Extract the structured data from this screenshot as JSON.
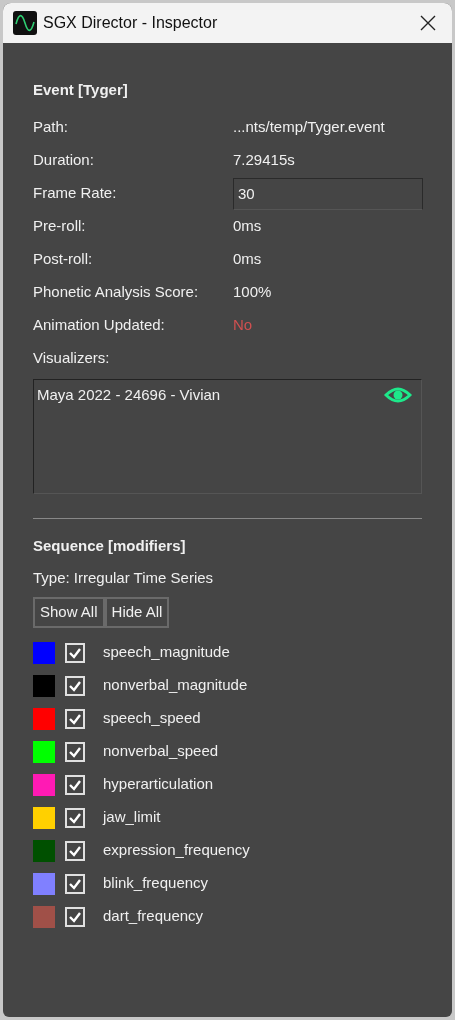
{
  "window": {
    "title": "SGX Director - Inspector"
  },
  "event": {
    "heading": "Event [Tyger]",
    "fields": [
      {
        "kind": "text",
        "label": "Path:",
        "value": "...nts/temp/Tyger.event"
      },
      {
        "kind": "text",
        "label": "Duration:",
        "value": "7.29415s"
      },
      {
        "kind": "input",
        "label": "Frame Rate:",
        "value": "30"
      },
      {
        "kind": "text",
        "label": "Pre-roll:",
        "value": "0ms"
      },
      {
        "kind": "text",
        "label": "Post-roll:",
        "value": "0ms"
      },
      {
        "kind": "text",
        "label": "Phonetic Analysis Score:",
        "value": "100%"
      },
      {
        "kind": "warning",
        "label": "Animation Updated:",
        "value": "No"
      }
    ],
    "visualizers_label": "Visualizers:",
    "visualizers": [
      {
        "name": "Maya 2022 - 24696 - Vivian",
        "visible": true
      }
    ]
  },
  "sequence": {
    "heading": "Sequence [modifiers]",
    "type": "Type: Irregular Time Series",
    "buttons": [
      "Show All",
      "Hide All"
    ],
    "modifiers": [
      {
        "name": "speech_magnitude",
        "color": "#0000ff",
        "checked": true
      },
      {
        "name": "nonverbal_magnitude",
        "color": "#000000",
        "checked": true
      },
      {
        "name": "speech_speed",
        "color": "#ff0000",
        "checked": true
      },
      {
        "name": "nonverbal_speed",
        "color": "#00ff00",
        "checked": true
      },
      {
        "name": "hyperarticulation",
        "color": "#ff1ab4",
        "checked": true
      },
      {
        "name": "jaw_limit",
        "color": "#ffd000",
        "checked": true
      },
      {
        "name": "expression_frequency",
        "color": "#005000",
        "checked": true
      },
      {
        "name": "blink_frequency",
        "color": "#8080ff",
        "checked": true
      },
      {
        "name": "dart_frequency",
        "color": "#a05048",
        "checked": true
      }
    ]
  }
}
